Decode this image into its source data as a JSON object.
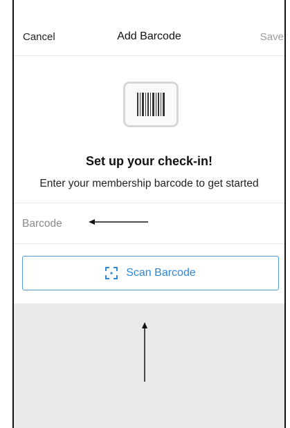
{
  "navbar": {
    "cancel_label": "Cancel",
    "title": "Add Barcode",
    "save_label": "Save"
  },
  "hero": {
    "icon": "barcode-icon",
    "title": "Set up your check-in!",
    "subtitle": "Enter your membership barcode to get started"
  },
  "barcode_field": {
    "placeholder": "Barcode",
    "value": ""
  },
  "scan_button": {
    "icon": "scan-icon",
    "label": "Scan Barcode"
  },
  "colors": {
    "accent": "#2d86d3",
    "save_disabled": "#9b9b9b",
    "camera_area": "#e9e9e9"
  }
}
